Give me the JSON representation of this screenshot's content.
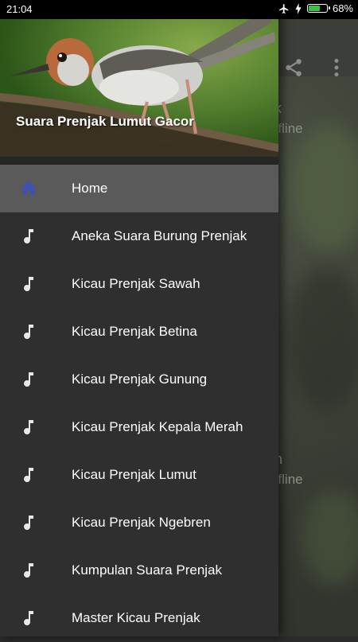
{
  "status_bar": {
    "time": "21:04",
    "battery_pct": "68%",
    "battery_level": 0.68
  },
  "drawer": {
    "header_title": "Suara Prenjak Lumut Gacor",
    "items": [
      {
        "label": "Home",
        "icon": "home-icon",
        "active": true
      },
      {
        "label": "Aneka Suara Burung Prenjak",
        "icon": "music-note-icon"
      },
      {
        "label": "Kicau Prenjak Sawah",
        "icon": "music-note-icon"
      },
      {
        "label": "Kicau Prenjak Betina",
        "icon": "music-note-icon"
      },
      {
        "label": "Kicau Prenjak Gunung",
        "icon": "music-note-icon"
      },
      {
        "label": "Kicau Prenjak Kepala Merah",
        "icon": "music-note-icon"
      },
      {
        "label": "Kicau Prenjak Lumut",
        "icon": "music-note-icon"
      },
      {
        "label": "Kicau Prenjak Ngebren",
        "icon": "music-note-icon"
      },
      {
        "label": "Kumpulan Suara Prenjak",
        "icon": "music-note-icon"
      },
      {
        "label": "Master Kicau Prenjak",
        "icon": "music-note-icon"
      }
    ]
  },
  "background": {
    "card1_title": "k",
    "card1_sub": "ffline",
    "card2_title": "n",
    "card2_sub": "ffline"
  },
  "colors": {
    "accent": "#3f51b5",
    "drawer_bg": "#2f2f2f",
    "active_row": "#5a5a5a",
    "battery": "#36c43a"
  }
}
